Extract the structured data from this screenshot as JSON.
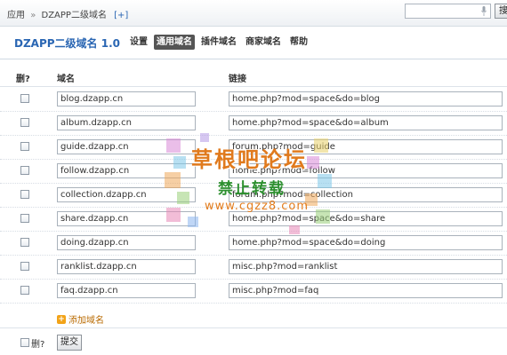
{
  "breadcrumb": {
    "root": "应用",
    "separator": "»",
    "current": "DZAPP二级域名",
    "plus": "[+]"
  },
  "search": {
    "placeholder": "",
    "button_label": "搜"
  },
  "header": {
    "app_title": "DZAPP二级域名 1.0",
    "nav": [
      {
        "label": "设置",
        "active": false
      },
      {
        "label": "通用域名",
        "active": true
      },
      {
        "label": "插件域名",
        "active": false
      },
      {
        "label": "商家域名",
        "active": false
      },
      {
        "label": "帮助",
        "active": false
      }
    ]
  },
  "table": {
    "columns": {
      "delete": "删?",
      "domain": "域名",
      "link": "链接"
    },
    "rows": [
      {
        "domain": "blog.dzapp.cn",
        "link": "home.php?mod=space&do=blog"
      },
      {
        "domain": "album.dzapp.cn",
        "link": "home.php?mod=space&do=album"
      },
      {
        "domain": "guide.dzapp.cn",
        "link": "forum.php?mod=guide"
      },
      {
        "domain": "follow.dzapp.cn",
        "link": "home.php?mod=follow"
      },
      {
        "domain": "collection.dzapp.cn",
        "link": "forum.php?mod=collection"
      },
      {
        "domain": "share.dzapp.cn",
        "link": "home.php?mod=space&do=share"
      },
      {
        "domain": "doing.dzapp.cn",
        "link": "home.php?mod=space&do=doing"
      },
      {
        "domain": "ranklist.dzapp.cn",
        "link": "misc.php?mod=ranklist"
      },
      {
        "domain": "faq.dzapp.cn",
        "link": "misc.php?mod=faq"
      }
    ]
  },
  "add_domain": {
    "label": "添加域名",
    "icon": "plus-icon"
  },
  "footer": {
    "delete_label": "删?",
    "submit_label": "提交"
  },
  "watermark": {
    "title": "草根吧论坛",
    "subtitle": "禁止转载",
    "url": "www.cgzz8.com"
  },
  "colors": {
    "accent": "#2a66b3",
    "active_tab": "#555555",
    "add_icon": "#f2a318"
  }
}
